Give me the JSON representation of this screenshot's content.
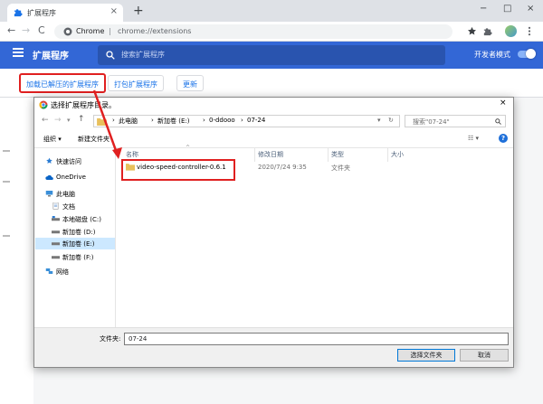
{
  "browser": {
    "tab_title": "扩展程序",
    "tab_close": "×",
    "new_tab": "+",
    "window_controls": [
      "−",
      "□",
      "×"
    ],
    "nav": {
      "back": "←",
      "forward": "→",
      "reload": "C"
    },
    "url_site": "Chrome",
    "url_sep": "|",
    "url_path": "chrome://extensions",
    "toolbar_icons": [
      "star-icon",
      "puzzle-icon",
      "avatar",
      "kebab-menu-icon"
    ]
  },
  "extensions": {
    "title": "扩展程序",
    "search_placeholder": "搜索扩展程序",
    "dev_mode_label": "开发者模式",
    "dev_mode_on": true,
    "buttons": {
      "load_unpacked": "加载已解压的扩展程序",
      "pack": "打包扩展程序",
      "update": "更新"
    },
    "accent": "#3367d6"
  },
  "dialog": {
    "title": "选择扩展程序目录。",
    "close": "×",
    "breadcrumb": [
      "此电脑",
      "新加卷 (E:)",
      "0-ddooo",
      "07-24"
    ],
    "search_placeholder": "搜索\"07-24\"",
    "organize": "组织 ▾",
    "new_folder": "新建文件夹",
    "nav_items": [
      {
        "label": "快速访问",
        "icon": "star-icon",
        "indent": 0
      },
      {
        "label": "OneDrive",
        "icon": "cloud-icon",
        "indent": 0
      },
      {
        "label": "此电脑",
        "icon": "computer-icon",
        "indent": 0
      },
      {
        "label": "文档",
        "icon": "document-icon",
        "indent": 1
      },
      {
        "label": "本地磁盘 (C:)",
        "icon": "drive-icon",
        "indent": 1
      },
      {
        "label": "新加卷 (D:)",
        "icon": "drive-icon",
        "indent": 1
      },
      {
        "label": "新加卷 (E:)",
        "icon": "drive-icon",
        "indent": 1,
        "selected": true
      },
      {
        "label": "新加卷 (F:)",
        "icon": "drive-icon",
        "indent": 1
      },
      {
        "label": "网络",
        "icon": "network-icon",
        "indent": 0
      }
    ],
    "columns": [
      "名称",
      "修改日期",
      "类型",
      "大小"
    ],
    "files": [
      {
        "name": "video-speed-controller-0.6.1",
        "date": "2020/7/24 9:35",
        "type": "文件夹",
        "size": ""
      }
    ],
    "folder_label": "文件夹:",
    "folder_value": "07-24",
    "select_button": "选择文件夹",
    "cancel_button": "取消"
  },
  "highlight_color": "#e02020"
}
